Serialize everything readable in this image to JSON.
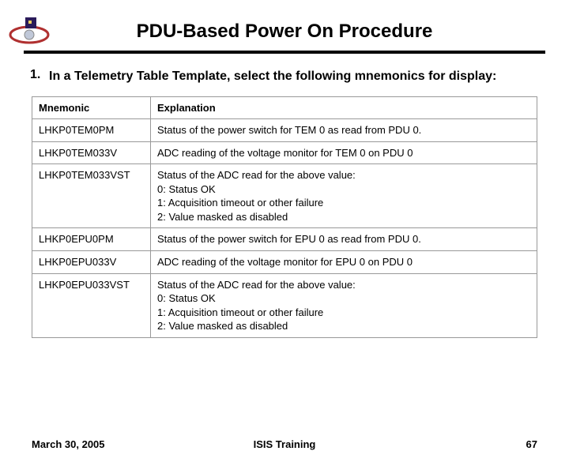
{
  "header": {
    "title": "PDU-Based Power On Procedure"
  },
  "step": {
    "number": "1.",
    "text": "In a Telemetry Table Template, select the following mnemonics for display:"
  },
  "table": {
    "headers": {
      "col1": "Mnemonic",
      "col2": "Explanation"
    },
    "rows": [
      {
        "mnemonic": "LHKP0TEM0PM",
        "explanation": "Status of the power switch for TEM 0 as read from PDU 0."
      },
      {
        "mnemonic": "LHKP0TEM033V",
        "explanation": "ADC reading of the voltage monitor for TEM 0 on PDU 0"
      },
      {
        "mnemonic": "LHKP0TEM033VST",
        "explanation": "Status of the ADC read for the above value:\n0: Status OK\n1: Acquisition timeout or other failure\n2: Value masked as disabled"
      },
      {
        "mnemonic": "LHKP0EPU0PM",
        "explanation": "Status of the power switch for EPU 0 as read from PDU 0."
      },
      {
        "mnemonic": "LHKP0EPU033V",
        "explanation": "ADC reading of the voltage monitor for EPU 0 on PDU 0"
      },
      {
        "mnemonic": "LHKP0EPU033VST",
        "explanation": "Status of the ADC read for the above value:\n0: Status OK\n1: Acquisition timeout or other failure\n2: Value masked as disabled"
      }
    ]
  },
  "footer": {
    "date": "March 30, 2005",
    "center": "ISIS Training",
    "page": "67"
  },
  "logo_name": "isis-logo"
}
